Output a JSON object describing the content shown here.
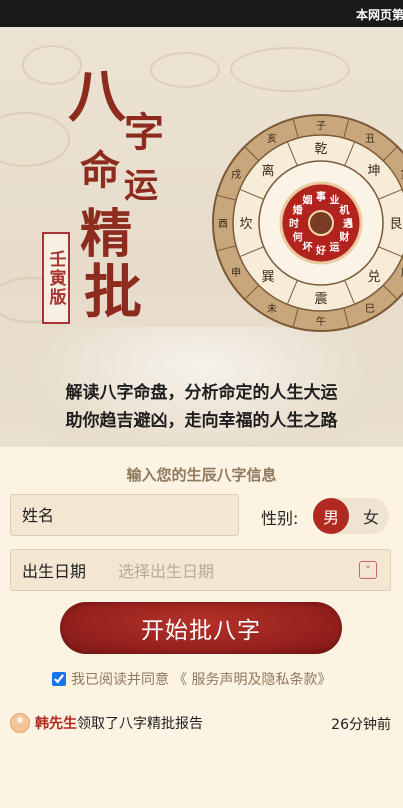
{
  "topbar": {
    "marquee": "本网页第"
  },
  "banner": {
    "title_chars": [
      "八",
      "字",
      "命",
      "运",
      "精",
      "批"
    ],
    "seal_text": "壬寅版",
    "wheel": {
      "center_chars": [
        "事",
        "业",
        "机",
        "遇",
        "财",
        "运",
        "好",
        "坏",
        "何",
        "时",
        "婚",
        "姻"
      ],
      "inner_ring": [
        "乾",
        "坤",
        "艮",
        "兑",
        "震",
        "巽",
        "坎",
        "离"
      ],
      "outer_ring": [
        "子",
        "丑",
        "寅",
        "卯",
        "辰",
        "巳",
        "午",
        "未",
        "申",
        "酉",
        "戌",
        "亥"
      ]
    },
    "subtitle_line1": "解读八字命盘，分析命定的人生大运",
    "subtitle_line2": "助你趋吉避凶，走向幸福的人生之路",
    "prev_arrow": "‹",
    "next_arrow": "›",
    "page_count": 8,
    "active_page": 1
  },
  "form": {
    "section_title": "输入您的生辰八字信息",
    "name_placeholder": "姓名",
    "gender_label": "性别:",
    "gender_male": "男",
    "gender_female": "女",
    "selected_gender": "男",
    "date_label": "出生日期",
    "date_placeholder": "选择出生日期",
    "date_dropdown_icon": "˅",
    "submit_label": "开始批八字",
    "agree_text": "我已阅读并同意",
    "agree_link": "《 服务声明及隐私条款》",
    "agree_checked": true
  },
  "notice": {
    "user": "韩先生",
    "message": "领取了八字精批报告",
    "time": "26分钟前"
  },
  "colors": {
    "accent": "#b02a22",
    "page_bg": "#fdf3e3",
    "muted_text": "#8f7a5e"
  }
}
